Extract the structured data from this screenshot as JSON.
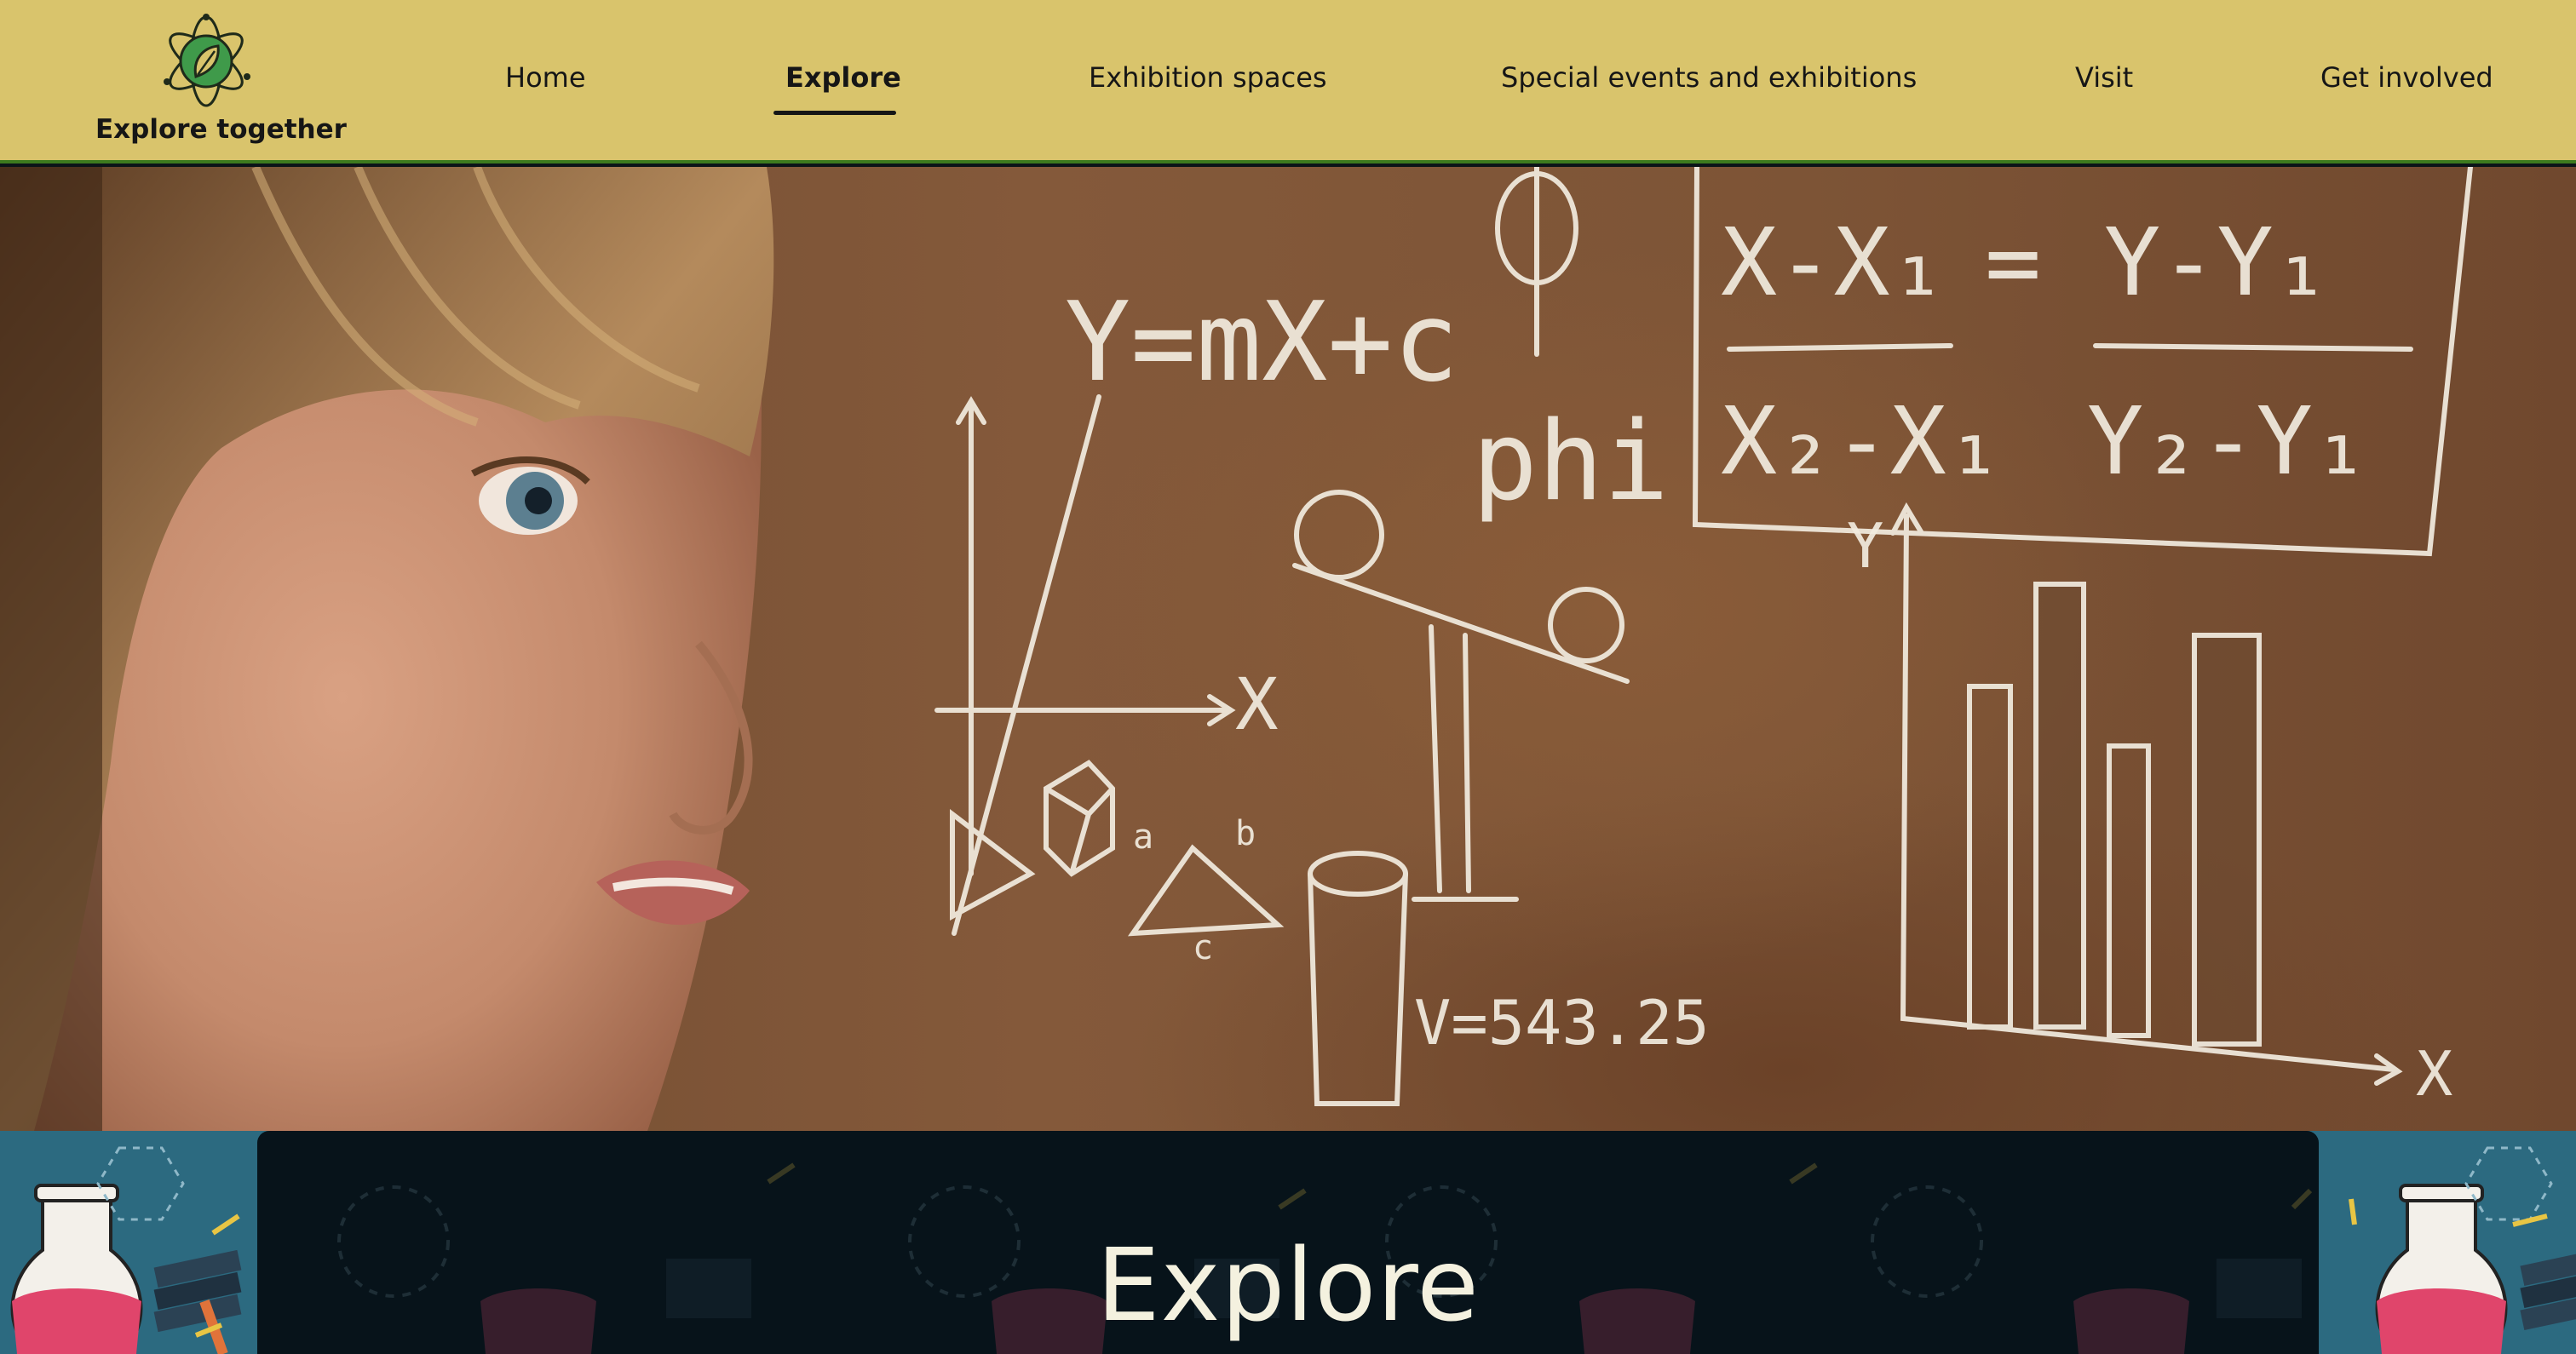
{
  "brand": {
    "name": "Explore together",
    "logo_icon": "atom-leaf-icon",
    "colors": {
      "header_bg": "#d9c46c",
      "header_border": "#3d7a1e",
      "logo_green": "#3f9a4a",
      "title_panel_bg": "#03090e",
      "title_text": "#f4f1df",
      "band_bg": "#2c6a80"
    }
  },
  "nav": {
    "items": [
      {
        "label": "Home",
        "active": false
      },
      {
        "label": "Explore",
        "active": true
      },
      {
        "label": "Exhibition spaces",
        "active": false
      },
      {
        "label": "Special events and exhibitions",
        "active": false
      },
      {
        "label": "Visit",
        "active": false
      },
      {
        "label": "Get involved",
        "active": false
      }
    ]
  },
  "hero": {
    "image": "girl-looking-at-chalkboard-photo",
    "chalk": {
      "line_equation": "Y=mX+c",
      "phi_symbol": "φ",
      "phi_word": "phi",
      "slope_left": "X-X₁",
      "slope_right": "Y-Y₁",
      "slope_left_den": "X₂-X₁",
      "slope_right_den": "Y₂-Y₁",
      "equals": "=",
      "volume": "V=543.25",
      "axis_x": "X",
      "axis_y": "Y",
      "tri_a": "a",
      "tri_b": "b",
      "tri_c": "c"
    }
  },
  "page": {
    "title": "Explore"
  }
}
